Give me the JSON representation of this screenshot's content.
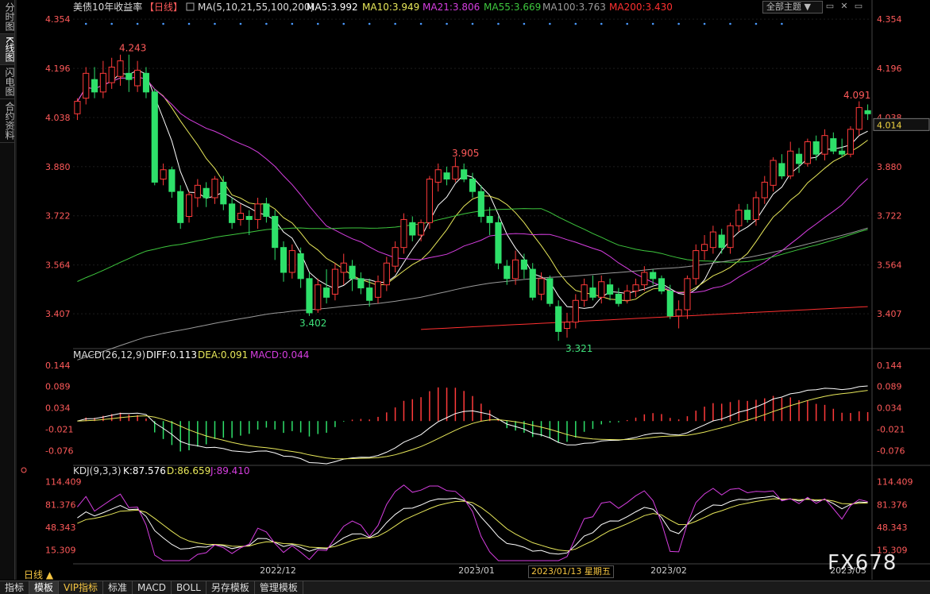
{
  "sidebar": {
    "tabs": [
      "分时图",
      "K线图",
      "闪电图",
      "合约资料"
    ],
    "active": 1
  },
  "header": {
    "symbol": "美债10年收益率",
    "period": "【日线】",
    "ma_label": "MA(5,10,21,55,100,200)",
    "ma_values": [
      {
        "text": "MA5:3.992",
        "color": "#ffffff"
      },
      {
        "text": "MA10:3.949",
        "color": "#e8e85a"
      },
      {
        "text": "MA21:3.806",
        "color": "#d63ee0"
      },
      {
        "text": "MA55:3.669",
        "color": "#3ec83e"
      },
      {
        "text": "MA100:3.763",
        "color": "#9a9a9a"
      },
      {
        "text": "MA200:3.430",
        "color": "#ff3030"
      }
    ],
    "theme_button": "全部主题",
    "window_icons": [
      "▭",
      "✕",
      "▭"
    ]
  },
  "price_axis": {
    "ticks": [
      "4.354",
      "4.196",
      "4.038",
      "3.880",
      "3.722",
      "3.564",
      "3.407"
    ],
    "current_label": "4.014",
    "ylim": [
      3.3,
      4.38
    ]
  },
  "macd": {
    "label": "MACD(26,12,9)",
    "diff": "DIFF:0.113",
    "dea": "DEA:0.091",
    "macd": "MACD:0.044",
    "ticks": [
      "0.144",
      "0.089",
      "0.034",
      "-0.021",
      "-0.076"
    ],
    "ylim": [
      -0.11,
      0.16
    ]
  },
  "kdj": {
    "label": "KDJ(9,3,3)",
    "k": "K:87.576",
    "d": "D:86.659",
    "j": "J:89.410",
    "ticks": [
      "114.409",
      "81.376",
      "48.343",
      "15.309"
    ],
    "ylim": [
      0,
      122
    ]
  },
  "xaxis": {
    "ticks": [
      "2022/12",
      "2023/01",
      "2023/02",
      "2023/03"
    ]
  },
  "annotations": {
    "high1": "4.243",
    "low1": "3.402",
    "high2": "3.905",
    "low2": "3.321",
    "high3": "4.091"
  },
  "tooltip_date": "2023/01/13 星期五",
  "footer": {
    "period_tag": "日线 ▲",
    "tabs": [
      "指标",
      "模板",
      "VIP指标",
      "标准",
      "MACD",
      "BOLL",
      "另存模板",
      "管理模板"
    ]
  },
  "watermark": "FX678",
  "chart_data": {
    "type": "candlestick",
    "candles": [
      [
        4.05,
        4.09,
        4.03,
        4.1
      ],
      [
        4.1,
        4.18,
        4.08,
        4.2
      ],
      [
        4.16,
        4.12,
        4.1,
        4.2
      ],
      [
        4.12,
        4.18,
        4.1,
        4.22
      ],
      [
        4.15,
        4.2,
        4.13,
        4.23
      ],
      [
        4.17,
        4.22,
        4.14,
        4.24
      ],
      [
        4.18,
        4.16,
        4.12,
        4.24
      ],
      [
        4.14,
        4.19,
        4.12,
        4.22
      ],
      [
        4.18,
        4.12,
        4.1,
        4.2
      ],
      [
        4.12,
        3.83,
        3.82,
        4.13
      ],
      [
        3.84,
        3.87,
        3.82,
        3.89
      ],
      [
        3.87,
        3.8,
        3.78,
        3.88
      ],
      [
        3.8,
        3.7,
        3.68,
        3.82
      ],
      [
        3.72,
        3.79,
        3.7,
        3.8
      ],
      [
        3.78,
        3.82,
        3.75,
        3.84
      ],
      [
        3.81,
        3.78,
        3.75,
        3.83
      ],
      [
        3.78,
        3.84,
        3.76,
        3.85
      ],
      [
        3.83,
        3.76,
        3.74,
        3.85
      ],
      [
        3.76,
        3.7,
        3.68,
        3.78
      ],
      [
        3.71,
        3.73,
        3.69,
        3.76
      ],
      [
        3.72,
        3.71,
        3.66,
        3.74
      ],
      [
        3.71,
        3.76,
        3.68,
        3.78
      ],
      [
        3.76,
        3.72,
        3.7,
        3.78
      ],
      [
        3.72,
        3.62,
        3.58,
        3.74
      ],
      [
        3.62,
        3.54,
        3.51,
        3.64
      ],
      [
        3.54,
        3.61,
        3.52,
        3.63
      ],
      [
        3.6,
        3.52,
        3.49,
        3.62
      ],
      [
        3.52,
        3.41,
        3.4,
        3.54
      ],
      [
        3.42,
        3.5,
        3.41,
        3.52
      ],
      [
        3.49,
        3.46,
        3.44,
        3.55
      ],
      [
        3.47,
        3.55,
        3.45,
        3.57
      ],
      [
        3.54,
        3.57,
        3.5,
        3.6
      ],
      [
        3.56,
        3.52,
        3.48,
        3.58
      ],
      [
        3.52,
        3.49,
        3.47,
        3.54
      ],
      [
        3.49,
        3.45,
        3.43,
        3.52
      ],
      [
        3.46,
        3.51,
        3.44,
        3.53
      ],
      [
        3.5,
        3.57,
        3.48,
        3.59
      ],
      [
        3.56,
        3.62,
        3.54,
        3.64
      ],
      [
        3.62,
        3.71,
        3.6,
        3.73
      ],
      [
        3.7,
        3.66,
        3.64,
        3.72
      ],
      [
        3.66,
        3.7,
        3.64,
        3.71
      ],
      [
        3.7,
        3.84,
        3.68,
        3.85
      ],
      [
        3.83,
        3.87,
        3.8,
        3.89
      ],
      [
        3.86,
        3.84,
        3.82,
        3.88
      ],
      [
        3.84,
        3.88,
        3.83,
        3.91
      ],
      [
        3.87,
        3.84,
        3.83,
        3.89
      ],
      [
        3.84,
        3.8,
        3.78,
        3.86
      ],
      [
        3.8,
        3.72,
        3.7,
        3.82
      ],
      [
        3.72,
        3.7,
        3.66,
        3.75
      ],
      [
        3.7,
        3.57,
        3.55,
        3.72
      ],
      [
        3.56,
        3.52,
        3.5,
        3.58
      ],
      [
        3.52,
        3.58,
        3.5,
        3.61
      ],
      [
        3.58,
        3.55,
        3.52,
        3.6
      ],
      [
        3.55,
        3.46,
        3.45,
        3.57
      ],
      [
        3.47,
        3.52,
        3.45,
        3.54
      ],
      [
        3.52,
        3.44,
        3.43,
        3.53
      ],
      [
        3.43,
        3.35,
        3.32,
        3.45
      ],
      [
        3.36,
        3.38,
        3.33,
        3.41
      ],
      [
        3.38,
        3.45,
        3.36,
        3.47
      ],
      [
        3.45,
        3.5,
        3.43,
        3.52
      ],
      [
        3.49,
        3.46,
        3.45,
        3.53
      ],
      [
        3.46,
        3.51,
        3.44,
        3.53
      ],
      [
        3.5,
        3.47,
        3.45,
        3.52
      ],
      [
        3.47,
        3.44,
        3.43,
        3.49
      ],
      [
        3.45,
        3.48,
        3.44,
        3.5
      ],
      [
        3.48,
        3.5,
        3.46,
        3.52
      ],
      [
        3.5,
        3.54,
        3.48,
        3.56
      ],
      [
        3.54,
        3.52,
        3.5,
        3.55
      ],
      [
        3.52,
        3.48,
        3.47,
        3.53
      ],
      [
        3.48,
        3.4,
        3.39,
        3.5
      ],
      [
        3.4,
        3.42,
        3.36,
        3.45
      ],
      [
        3.42,
        3.52,
        3.39,
        3.53
      ],
      [
        3.52,
        3.61,
        3.5,
        3.63
      ],
      [
        3.61,
        3.63,
        3.58,
        3.66
      ],
      [
        3.62,
        3.67,
        3.6,
        3.69
      ],
      [
        3.66,
        3.62,
        3.6,
        3.68
      ],
      [
        3.62,
        3.69,
        3.6,
        3.7
      ],
      [
        3.69,
        3.74,
        3.67,
        3.76
      ],
      [
        3.74,
        3.71,
        3.7,
        3.76
      ],
      [
        3.71,
        3.78,
        3.69,
        3.8
      ],
      [
        3.78,
        3.83,
        3.76,
        3.85
      ],
      [
        3.82,
        3.9,
        3.8,
        3.91
      ],
      [
        3.89,
        3.85,
        3.84,
        3.92
      ],
      [
        3.85,
        3.93,
        3.84,
        3.96
      ],
      [
        3.92,
        3.89,
        3.86,
        3.94
      ],
      [
        3.89,
        3.96,
        3.88,
        3.97
      ],
      [
        3.96,
        3.92,
        3.9,
        3.98
      ],
      [
        3.92,
        3.98,
        3.9,
        4.0
      ],
      [
        3.97,
        3.93,
        3.92,
        3.99
      ],
      [
        3.93,
        3.92,
        3.91,
        3.97
      ],
      [
        3.92,
        4.0,
        3.91,
        4.01
      ],
      [
        4.0,
        4.07,
        3.98,
        4.09
      ],
      [
        4.06,
        4.05,
        4.03,
        4.08
      ]
    ]
  }
}
